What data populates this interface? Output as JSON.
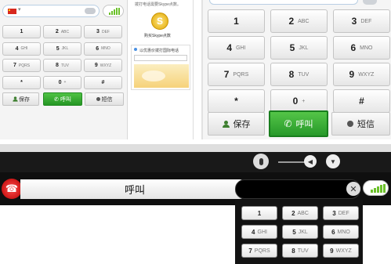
{
  "colors": {
    "call_green": "#2ea83b",
    "hangup_red": "#e21b1b",
    "signal_green": "#6cc12b",
    "dark_bar": "#111111"
  },
  "panel_small": {
    "keys": [
      {
        "d": "1",
        "l": ""
      },
      {
        "d": "2",
        "l": "ABC"
      },
      {
        "d": "3",
        "l": "DEF"
      },
      {
        "d": "4",
        "l": "GHI"
      },
      {
        "d": "5",
        "l": "JKL"
      },
      {
        "d": "6",
        "l": "MNO"
      },
      {
        "d": "7",
        "l": "PQRS"
      },
      {
        "d": "8",
        "l": "TUV"
      },
      {
        "d": "9",
        "l": "WXYZ"
      },
      {
        "d": "*",
        "l": ""
      },
      {
        "d": "0",
        "l": "+"
      },
      {
        "d": "#",
        "l": ""
      }
    ],
    "save_label": "保存",
    "call_label": "呼叫",
    "sms_label": "短信"
  },
  "ad_panel": {
    "top_text": "拨打电话需要Skype点数。",
    "buy_text": "购买Skype点数",
    "card_title": "以优惠价拨打国际电话"
  },
  "panel_large": {
    "keys": [
      {
        "d": "1",
        "l": ""
      },
      {
        "d": "2",
        "l": "ABC"
      },
      {
        "d": "3",
        "l": "DEF"
      },
      {
        "d": "4",
        "l": "GHI"
      },
      {
        "d": "5",
        "l": "JKL"
      },
      {
        "d": "6",
        "l": "MNO"
      },
      {
        "d": "7",
        "l": "PQRS"
      },
      {
        "d": "8",
        "l": "TUV"
      },
      {
        "d": "9",
        "l": "WXYZ"
      },
      {
        "d": "*",
        "l": ""
      },
      {
        "d": "0",
        "l": "+"
      },
      {
        "d": "#",
        "l": ""
      }
    ],
    "save_label": "保存",
    "call_label": "呼叫",
    "sms_label": "短信"
  },
  "bottom_bar": {
    "call_label": "呼叫",
    "clear_glyph": "✕",
    "keys": [
      {
        "d": "1",
        "l": ""
      },
      {
        "d": "2",
        "l": "ABC"
      },
      {
        "d": "3",
        "l": "DEF"
      },
      {
        "d": "4",
        "l": "GHI"
      },
      {
        "d": "5",
        "l": "JKL"
      },
      {
        "d": "6",
        "l": "MNO"
      },
      {
        "d": "7",
        "l": "PQRS"
      },
      {
        "d": "8",
        "l": "TUV"
      },
      {
        "d": "9",
        "l": "WXYZ"
      }
    ]
  }
}
